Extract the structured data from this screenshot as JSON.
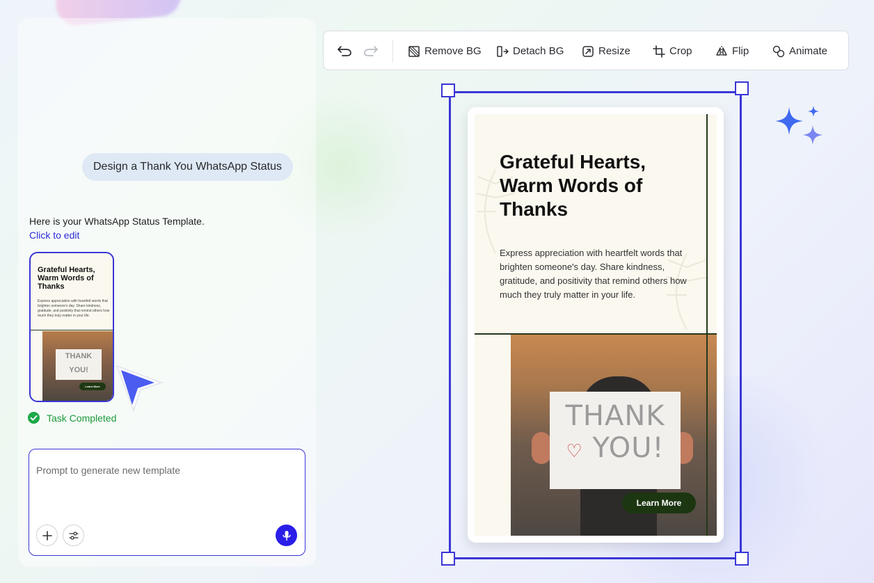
{
  "chat": {
    "user_message": "Design a Thank You WhatsApp Status",
    "bot_message": "Here is your WhatsApp Status Template.",
    "bot_link": "Click to edit",
    "thumbnail": {
      "title": "Grateful Hearts, Warm Words of Thanks",
      "body": "Express appreciation with heartfelt words that brighten someone's day. Share kindness, gratitude, and positivity that remind others how much they truly matter in your life.",
      "sign_text": "THANK YOU!",
      "button_label": "Learn More"
    },
    "status_label": "Task Completed",
    "prompt_placeholder": "Prompt to generate new template"
  },
  "toolbar": {
    "remove_bg": "Remove BG",
    "detach_bg": "Detach BG",
    "resize": "Resize",
    "crop": "Crop",
    "flip": "Flip",
    "animate": "Animate"
  },
  "canvas": {
    "title": "Grateful Hearts, Warm Words of Thanks",
    "body": "Express appreciation with heartfelt words that brighten someone's day. Share kindness, gratitude, and positivity that remind others how much they truly matter in your life.",
    "sign_line1": "THANK",
    "sign_line2": "YOU!",
    "button_label": "Learn More"
  },
  "colors": {
    "accent": "#3a36d6",
    "mic": "#2a1ee8",
    "success": "#1b9a3a",
    "card_bg": "#fbf8ef",
    "card_dark_green": "#1c3611",
    "sparkle": "#4a6cf0"
  }
}
